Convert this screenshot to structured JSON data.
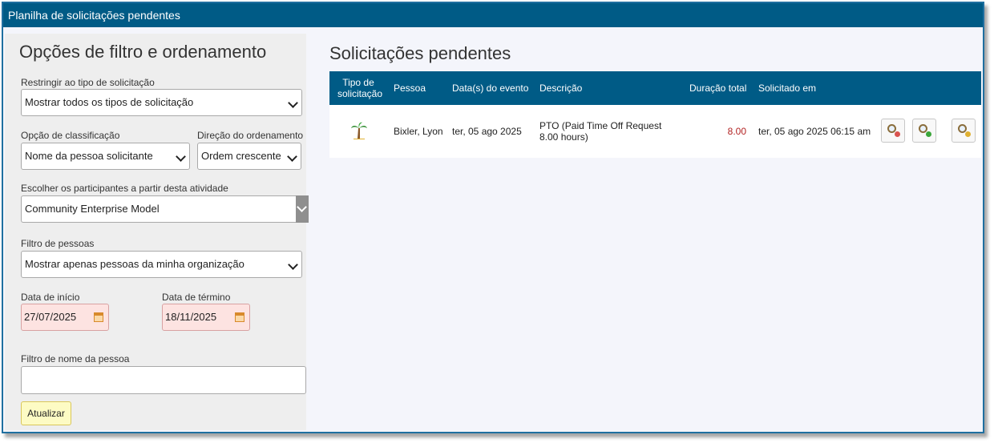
{
  "window": {
    "title": "Planilha de solicitações pendentes"
  },
  "filters": {
    "heading": "Opções de filtro e ordenamento",
    "request_type": {
      "label": "Restringir ao tipo de solicitação",
      "value": "Mostrar todos os tipos de solicitação"
    },
    "sort_option": {
      "label": "Opção de classificação",
      "value": "Nome da pessoa solicitante"
    },
    "sort_direction": {
      "label": "Direção do ordenamento",
      "value": "Ordem crescente"
    },
    "activity": {
      "label": "Escolher os participantes a partir desta atividade",
      "value": "Community Enterprise Model"
    },
    "people_filter": {
      "label": "Filtro de pessoas",
      "value": "Mostrar apenas pessoas da minha organização"
    },
    "start_date": {
      "label": "Data de início",
      "value": "27/07/2025"
    },
    "end_date": {
      "label": "Data de término",
      "value": "18/11/2025"
    },
    "name_filter": {
      "label": "Filtro de nome da pessoa",
      "value": ""
    },
    "update_label": "Atualizar"
  },
  "requests": {
    "heading": "Solicitações pendentes",
    "columns": {
      "type_line1": "Tipo de",
      "type_line2": "solicitação",
      "person": "Pessoa",
      "event_dates": "Data(s) do evento",
      "description": "Descrição",
      "total_duration": "Duração total",
      "requested_at": "Solicitado em"
    },
    "rows": [
      {
        "type_icon": "palm-tree-icon",
        "person": "Bixler, Lyon",
        "event_date": "ter, 05 ago 2025",
        "description_line1": "PTO (Paid Time Off Request",
        "description_line2": "8.00 hours)",
        "duration": "8.00",
        "requested_at": "ter, 05 ago 2025 06:15 am"
      }
    ],
    "duration_color": "#b22222",
    "header_color": "#005b86"
  }
}
